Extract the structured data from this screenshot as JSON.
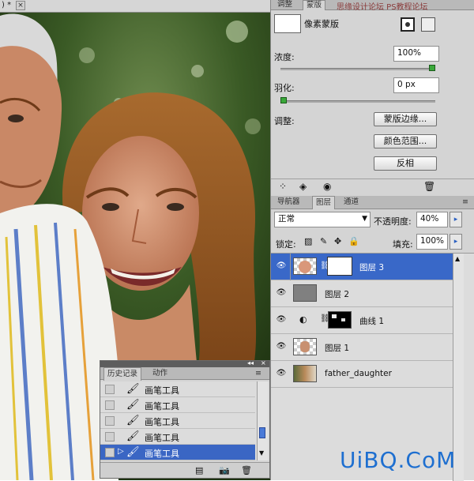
{
  "document": {
    "tab_title": ") *",
    "close_glyph": "×"
  },
  "watermark_top": "思缘设计论坛  PS教程论坛",
  "watermark_bottom": "UiBQ.CoM",
  "mask_panel": {
    "tabs": [
      "调整",
      "蒙版"
    ],
    "active_tab": 1,
    "mask_type": "像素蒙版",
    "density_label": "浓度:",
    "density_value": "100%",
    "density_level": 1.0,
    "feather_label": "羽化:",
    "feather_value": "0 px",
    "feather_level": 0.0,
    "refine_label": "调整:",
    "buttons": [
      "蒙版边缘...",
      "颜色范围...",
      "反相"
    ]
  },
  "layers_panel": {
    "tabs": [
      "导航器",
      "图层",
      "通道"
    ],
    "active_tab": 1,
    "blend_mode": "正常",
    "opacity_label": "不透明度:",
    "opacity_value": "40%",
    "lock_label": "锁定:",
    "fill_label": "填充:",
    "fill_value": "100%",
    "layers": [
      {
        "name": "图层 3",
        "selected": true,
        "has_mask": true
      },
      {
        "name": "图层 2",
        "selected": false,
        "has_mask": false
      },
      {
        "name": "曲线 1",
        "selected": false,
        "has_mask": true,
        "adjustment": true
      },
      {
        "name": "图层 1",
        "selected": false,
        "has_mask": false
      },
      {
        "name": "father_daughter",
        "selected": false,
        "has_mask": false
      }
    ]
  },
  "history_panel": {
    "tabs": [
      "历史记录",
      "动作"
    ],
    "active_tab": 0,
    "items": [
      "画笔工具",
      "画笔工具",
      "画笔工具",
      "画笔工具",
      "画笔工具"
    ],
    "selected_index": 4
  },
  "colors": {
    "selection": "#3968c8",
    "panel_bg": "#d4d4d4",
    "slider_green": "#3aa83a"
  }
}
